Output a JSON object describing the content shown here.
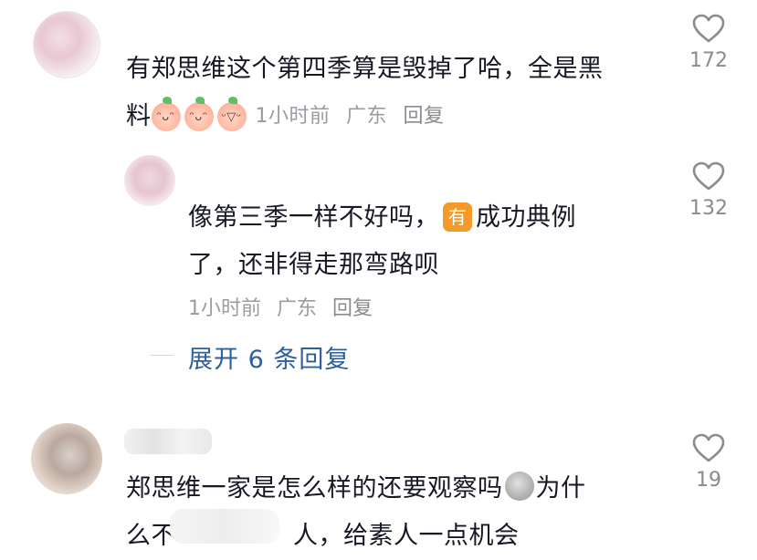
{
  "comments": [
    {
      "text_line1": "有郑思维这个第四季算是毁掉了哈，全是黑",
      "text_line2": "料",
      "emojis": [
        "smile-peach-emoji",
        "smile-peach-emoji",
        "cry-laugh-peach-emoji"
      ],
      "time": "1小时前",
      "location": "广东",
      "reply_label": "回复",
      "like_count": "172"
    },
    {
      "text_line1_a": "像第三季一样不好吗，",
      "badge": "有",
      "text_line1_b": "成功典例",
      "text_line2": "了，还非得走那弯路呗",
      "time": "1小时前",
      "location": "广东",
      "reply_label": "回复",
      "like_count": "132"
    },
    {
      "text_line1": "郑思维一家是怎么样的还要观察吗",
      "text_line1_b": "为什",
      "text_line2_a": "么不",
      "text_line2_b": "人，给素人一点机会",
      "like_count": "19"
    }
  ],
  "expand_replies": "展开 6 条回复",
  "icons": {
    "like": "heart-outline-icon"
  },
  "colors": {
    "text": "#161823",
    "meta": "#9b9ca3",
    "link": "#2d5f9a",
    "badge": "#f39a29"
  }
}
